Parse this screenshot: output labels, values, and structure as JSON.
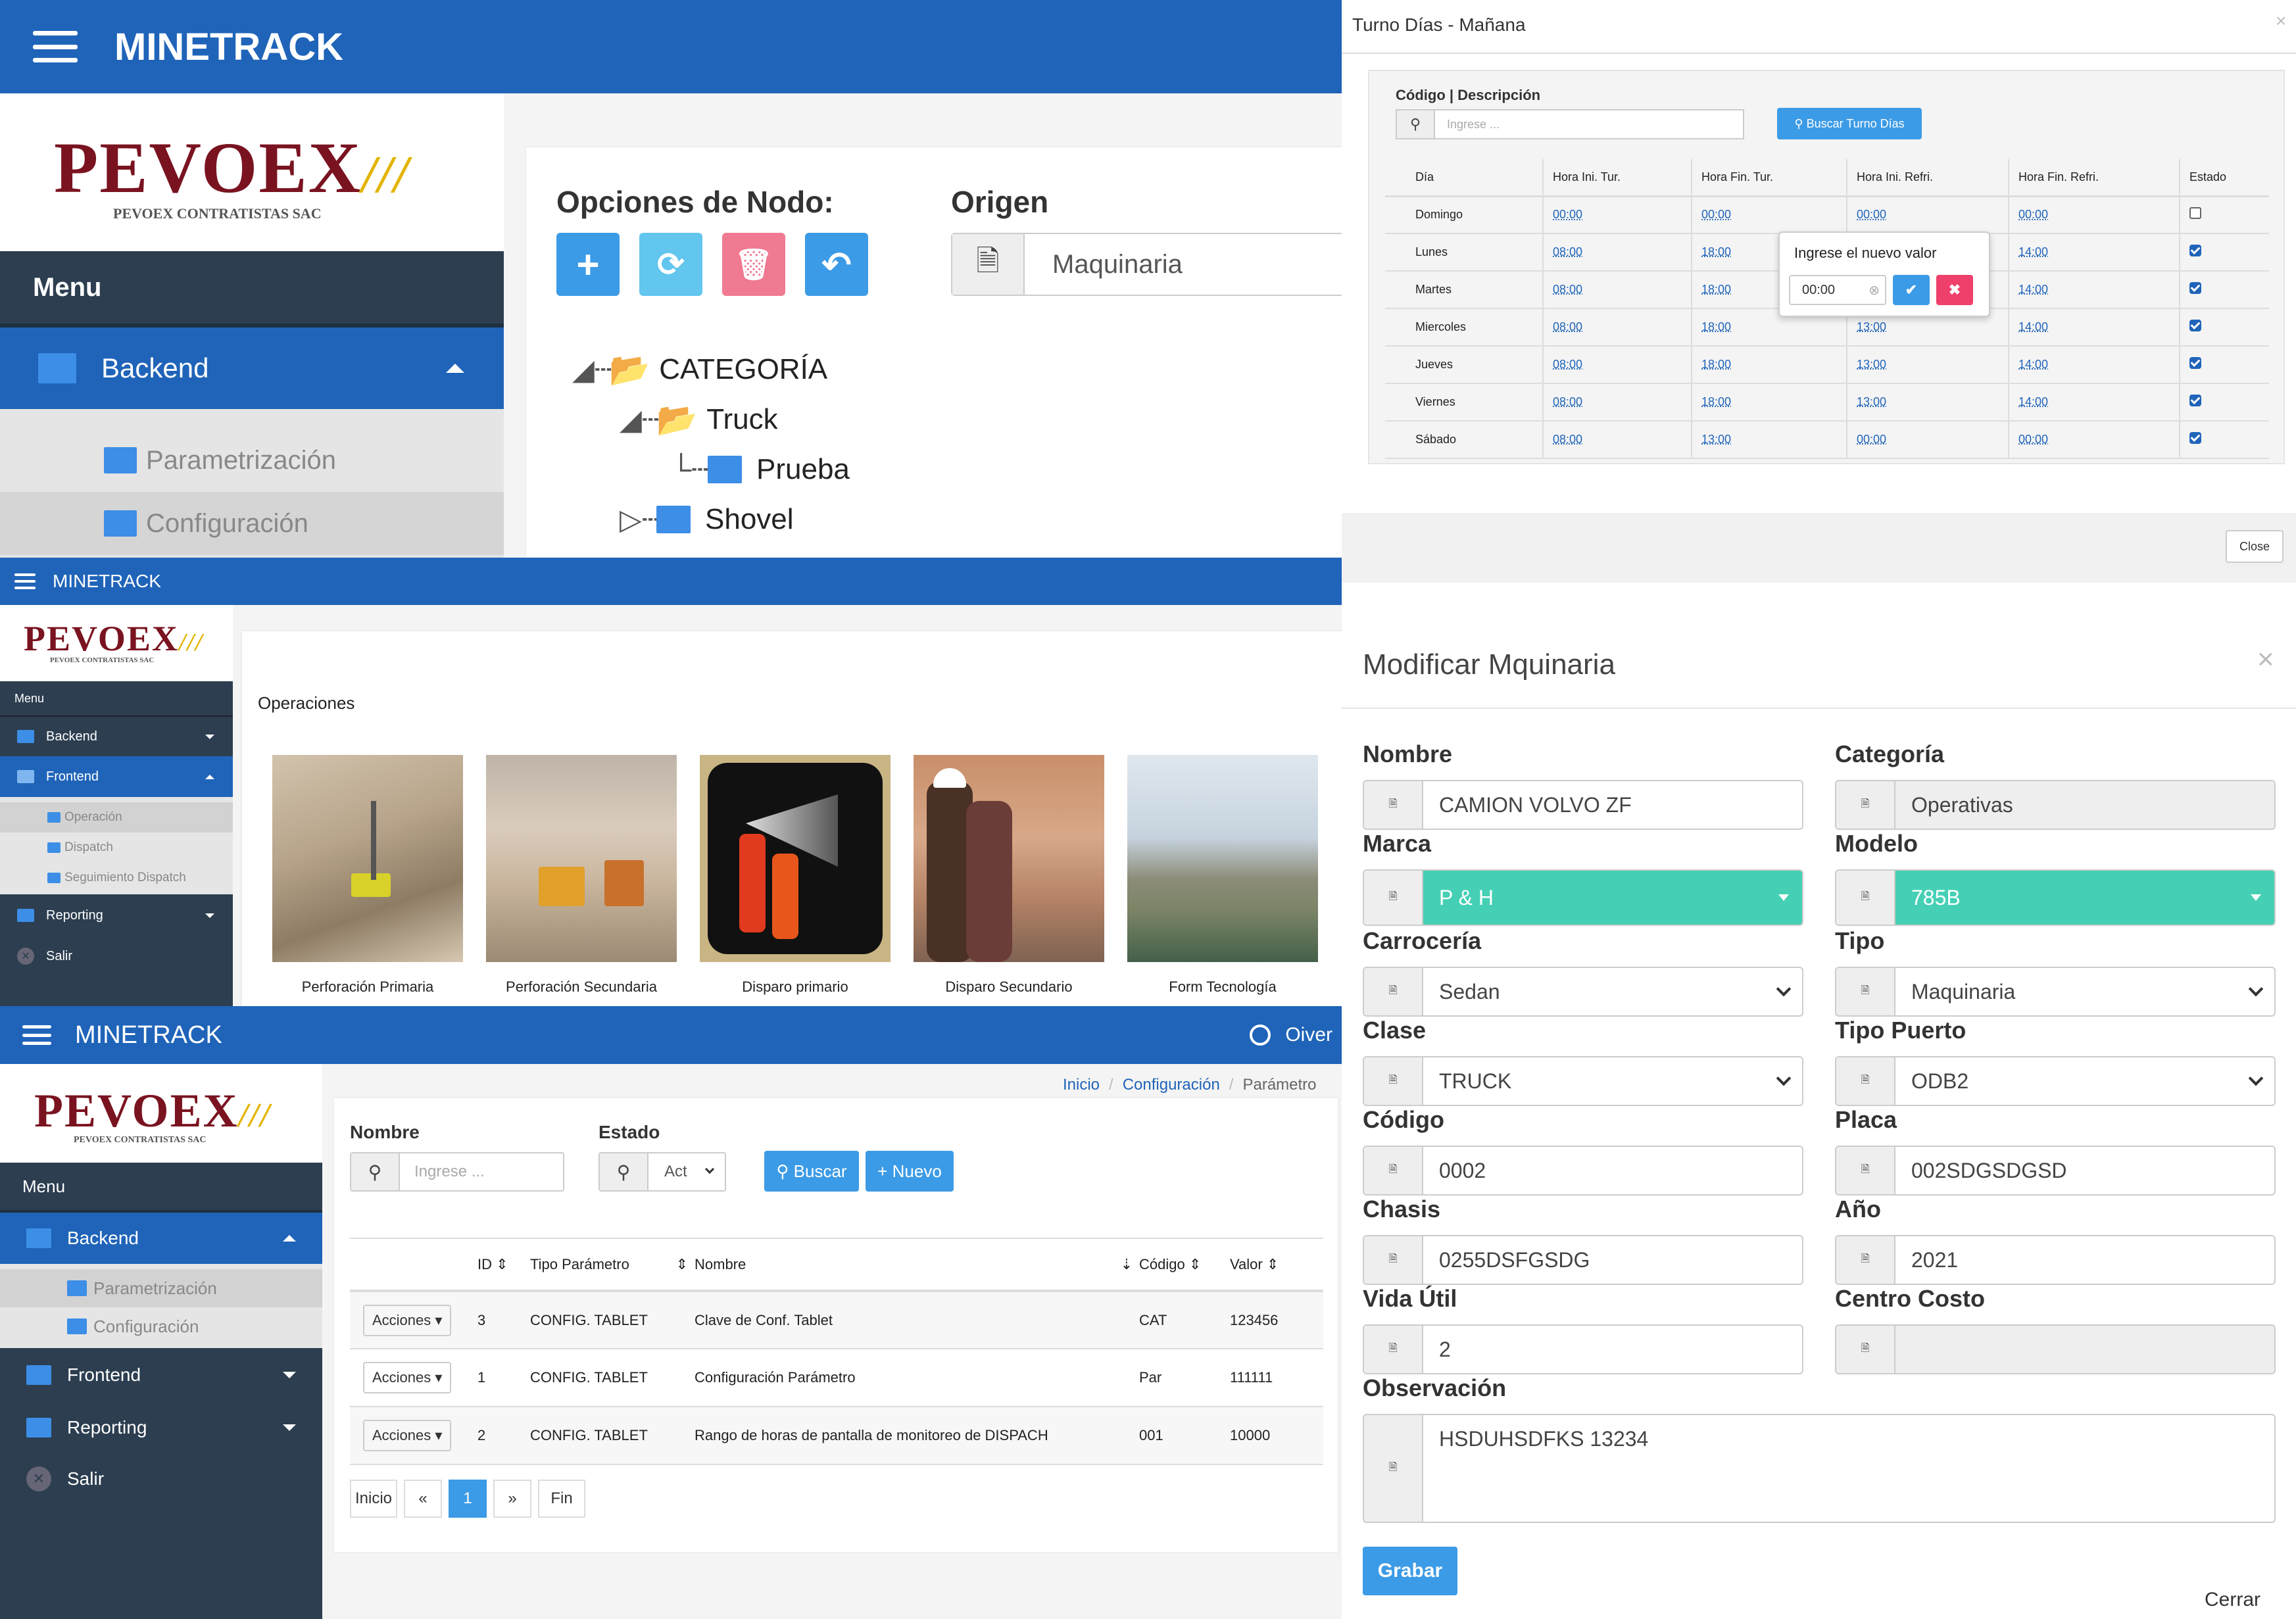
{
  "brand": {
    "logo": "PEVOEX",
    "logo_sub": "PEVOEX CONTRATISTAS SAC"
  },
  "p1": {
    "app": "MINETRACK",
    "menu": "Menu",
    "backend": "Backend",
    "sub1": "Parametrización",
    "sub2": "Configuración",
    "opciones_title": "Opciones de Nodo:",
    "origen_title": "Origen",
    "origen_value": "Maquinaria",
    "tree": {
      "root": "CATEGORÍA",
      "n1": "Truck",
      "n1a": "Prueba",
      "n2": "Shovel"
    }
  },
  "p2": {
    "app": "MINETRACK",
    "menu": "Menu",
    "items": {
      "backend": "Backend",
      "frontend": "Frontend",
      "operacion": "Operación",
      "dispatch": "Dispatch",
      "seguimiento": "Seguimiento Dispatch",
      "reporting": "Reporting",
      "salir": "Salir"
    },
    "section": "Operaciones",
    "cards": [
      "Perforación Primaria",
      "Perforación Secundaria",
      "Disparo primario",
      "Disparo Secundario",
      "Form Tecnología"
    ]
  },
  "p3": {
    "app": "MINETRACK",
    "user": "Oiver",
    "menu": "Menu",
    "items": {
      "backend": "Backend",
      "param": "Parametrización",
      "config": "Configuración",
      "frontend": "Frontend",
      "reporting": "Reporting",
      "salir": "Salir"
    },
    "breadcrumb": {
      "b1": "Inicio",
      "b2": "Configuración",
      "b3": "Parámetro"
    },
    "nombre_label": "Nombre",
    "nombre_placeholder": "Ingrese ...",
    "estado_label": "Estado",
    "estado_value": "Act",
    "buscar": "Buscar",
    "nuevo": "Nuevo",
    "headers": [
      "ID",
      "Tipo Parámetro",
      "Nombre",
      "Código",
      "Valor"
    ],
    "acciones": "Acciones",
    "rows": [
      {
        "id": "3",
        "tipo": "CONFIG. TABLET",
        "nombre": "Clave de Conf. Tablet",
        "codigo": "CAT",
        "valor": "123456"
      },
      {
        "id": "1",
        "tipo": "CONFIG. TABLET",
        "nombre": "Configuración Parámetro",
        "codigo": "Par",
        "valor": "111111"
      },
      {
        "id": "2",
        "tipo": "CONFIG. TABLET",
        "nombre": "Rango de horas de pantalla de monitoreo de DISPACH",
        "codigo": "001",
        "valor": "10000"
      }
    ],
    "pager": {
      "first": "Inicio",
      "prev": "«",
      "current": "1",
      "next": "»",
      "last": "Fin"
    }
  },
  "p4": {
    "title": "Turno Días - Mañana",
    "label": "Código | Descripción",
    "placeholder": "Ingrese ...",
    "buscar": "Buscar Turno Días",
    "headers": [
      "Día",
      "Hora Ini. Tur.",
      "Hora Fin. Tur.",
      "Hora Ini. Refri.",
      "Hora Fin. Refri.",
      "Estado"
    ],
    "rows": [
      {
        "d": "Domingo",
        "a": "00:00",
        "b": "00:00",
        "c": "00:00",
        "e": "00:00",
        "chk": false
      },
      {
        "d": "Lunes",
        "a": "08:00",
        "b": "18:00",
        "c": "",
        "e": "14:00",
        "chk": true
      },
      {
        "d": "Martes",
        "a": "08:00",
        "b": "18:00",
        "c": "",
        "e": "14:00",
        "chk": true
      },
      {
        "d": "Miercoles",
        "a": "08:00",
        "b": "18:00",
        "c": "13:00",
        "e": "14:00",
        "chk": true
      },
      {
        "d": "Jueves",
        "a": "08:00",
        "b": "18:00",
        "c": "13:00",
        "e": "14:00",
        "chk": true
      },
      {
        "d": "Viernes",
        "a": "08:00",
        "b": "18:00",
        "c": "13:00",
        "e": "14:00",
        "chk": true
      },
      {
        "d": "Sábado",
        "a": "08:00",
        "b": "13:00",
        "c": "00:00",
        "e": "00:00",
        "chk": true
      }
    ],
    "popup_title": "Ingrese el nuevo valor",
    "popup_value": "00:00",
    "close": "Close"
  },
  "p5": {
    "title": "Modificar Mquinaria",
    "fields": {
      "nombre": {
        "label": "Nombre",
        "value": "CAMION VOLVO ZF"
      },
      "categoria": {
        "label": "Categoría",
        "value": "Operativas"
      },
      "marca": {
        "label": "Marca",
        "value": "P & H"
      },
      "modelo": {
        "label": "Modelo",
        "value": "785B"
      },
      "carroceria": {
        "label": "Carrocería",
        "value": "Sedan"
      },
      "tipo": {
        "label": "Tipo",
        "value": "Maquinaria"
      },
      "clase": {
        "label": "Clase",
        "value": "TRUCK"
      },
      "tipo_puerto": {
        "label": "Tipo Puerto",
        "value": "ODB2"
      },
      "codigo": {
        "label": "Código",
        "value": "0002"
      },
      "placa": {
        "label": "Placa",
        "value": "002SDGSDGSD"
      },
      "chasis": {
        "label": "Chasis",
        "value": "0255DSFGSDG"
      },
      "anio": {
        "label": "Año",
        "value": "2021"
      },
      "vida": {
        "label": "Vida Útil",
        "value": "2"
      },
      "centro": {
        "label": "Centro Costo",
        "value": ""
      },
      "obs": {
        "label": "Observación",
        "value": "HSDUHSDFKS 13234"
      }
    },
    "grabar": "Grabar",
    "cerrar": "Cerrar"
  },
  "colors": {
    "primary": "#1f64b9",
    "sidebar": "#2c3e50",
    "teal": "#45d0b5",
    "danger": "#ef3f6b",
    "info": "#3c9be6"
  }
}
